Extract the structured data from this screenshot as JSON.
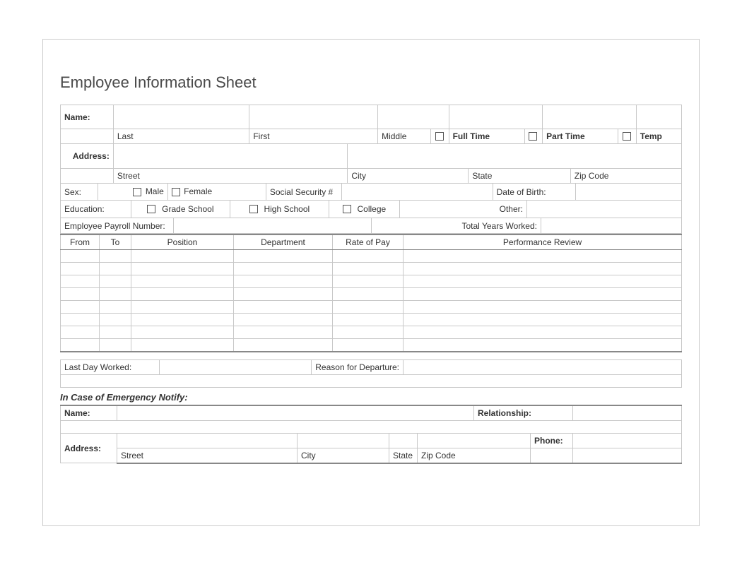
{
  "title": "Employee Information Sheet",
  "nameRow": {
    "label": "Name:",
    "last": "Last",
    "first": "First",
    "middle": "Middle",
    "fullTime": "Full Time",
    "partTime": "Part Time",
    "temp": "Temp"
  },
  "addressRow": {
    "label": "Address:",
    "street": "Street",
    "city": "City",
    "state": "State",
    "zip": "Zip Code"
  },
  "sexRow": {
    "label": "Sex:",
    "male": "Male",
    "female": "Female",
    "ssn": "Social Security #",
    "dob": "Date of Birth:"
  },
  "educationRow": {
    "label": "Education:",
    "grade": "Grade School",
    "high": "High School",
    "college": "College",
    "other": "Other:"
  },
  "payrollRow": {
    "label": "Employee Payroll Number:",
    "totalYears": "Total Years Worked:"
  },
  "workHistory": {
    "headers": [
      "From",
      "To",
      "Position",
      "Department",
      "Rate of Pay",
      "Performance Review"
    ]
  },
  "departure": {
    "lastDay": "Last Day Worked:",
    "reason": "Reason for Departure:"
  },
  "emergency": {
    "heading": "In Case of Emergency Notify:",
    "name": "Name:",
    "relationship": "Relationship:",
    "address": "Address:",
    "street": "Street",
    "city": "City",
    "state": "State",
    "zip": "Zip Code",
    "phone": "Phone:"
  }
}
